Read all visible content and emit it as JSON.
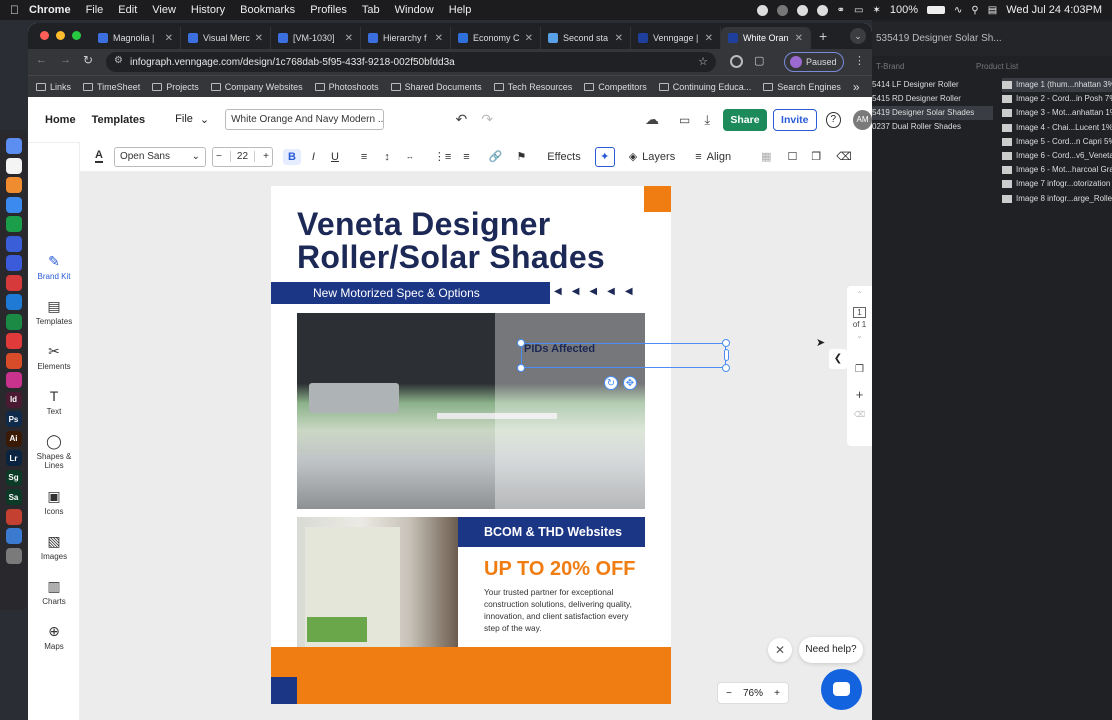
{
  "menubar": {
    "apple": "",
    "items": [
      "Chrome",
      "File",
      "Edit",
      "View",
      "History",
      "Bookmarks",
      "Profiles",
      "Tab",
      "Window",
      "Help"
    ],
    "battery": "100%",
    "datetime": "Wed Jul 24  4:03PM"
  },
  "dock": {
    "apps": [
      {
        "label": "",
        "color": "#5b8ef0"
      },
      {
        "label": "",
        "color": "#f4f4f4"
      },
      {
        "label": "",
        "color": "#f08c30"
      },
      {
        "label": "",
        "color": "#3a8af0"
      },
      {
        "label": "",
        "color": "#1b9e4a"
      },
      {
        "label": "",
        "color": "#3a5dd8"
      },
      {
        "label": "",
        "color": "#3b5bdb"
      },
      {
        "label": "",
        "color": "#d63a3a"
      },
      {
        "label": "",
        "color": "#1f7ad6"
      },
      {
        "label": "",
        "color": "#1a8a45"
      },
      {
        "label": "",
        "color": "#e03a3a"
      },
      {
        "label": "",
        "color": "#d94c2a"
      },
      {
        "label": "",
        "color": "#c9338e"
      },
      {
        "label": "Id",
        "color": "#4a1a33"
      },
      {
        "label": "Ps",
        "color": "#0f2a4a"
      },
      {
        "label": "Ai",
        "color": "#3a1a05"
      },
      {
        "label": "Lr",
        "color": "#0a2340"
      },
      {
        "label": "Sg",
        "color": "#0b3a26"
      },
      {
        "label": "Sa",
        "color": "#0b3a26"
      },
      {
        "label": "",
        "color": "#c44030"
      },
      {
        "label": "",
        "color": "#3a7ad0"
      },
      {
        "label": "",
        "color": "#7a7a7a"
      }
    ]
  },
  "right_panel": {
    "title": "535419 Designer Solar Sh...",
    "col_a": "T-Brand",
    "col_b": "Product List",
    "list_a": [
      {
        "text": "5414 LF Designer Roller",
        "selected": false
      },
      {
        "text": "5415 RD Designer Roller",
        "selected": false
      },
      {
        "text": "5419 Designer Solar Shades",
        "selected": true
      },
      {
        "text": "0237 Dual Roller Shades",
        "selected": false
      }
    ],
    "list_b": [
      {
        "text": "Image 1 (thum...nhattan 3%",
        "selected": true
      },
      {
        "text": "Image 2 - Cord...in Posh 7%",
        "selected": false
      },
      {
        "text": "Image 3 - Mot...anhattan 1%",
        "selected": false
      },
      {
        "text": "Image 4 - Chai...Lucent 1%",
        "selected": false
      },
      {
        "text": "Image 5 - Cord...n Capri 5%",
        "selected": false
      },
      {
        "text": "Image 6 - Cord...v6_Veneta",
        "selected": false
      },
      {
        "text": "Image 6 - Mot...harcoal Gra",
        "selected": false
      },
      {
        "text": "Image 7 infogr...otorization",
        "selected": false
      },
      {
        "text": "Image 8 infogr...arge_Rolle",
        "selected": false
      }
    ]
  },
  "browser": {
    "tabs": [
      {
        "title": "Magnolia |",
        "color": "#3b6fe0",
        "active": false
      },
      {
        "title": "Visual Merc",
        "color": "#3b6fe0",
        "active": false
      },
      {
        "title": "[VM-1030]",
        "color": "#3b6fe0",
        "active": false
      },
      {
        "title": "Hierarchy f",
        "color": "#3b6fe0",
        "active": false
      },
      {
        "title": "Economy C",
        "color": "#2f6fdc",
        "active": false
      },
      {
        "title": "Second sta",
        "color": "#5aa0e6",
        "active": false
      },
      {
        "title": "Venngage |",
        "color": "#1e3f9c",
        "active": false
      },
      {
        "title": "White Oran",
        "color": "#1e3f9c",
        "active": true
      }
    ],
    "url": "infograph.venngage.com/design/1c768dab-5f95-433f-9218-002f50bfdd3a",
    "profile_label": "Paused",
    "bookmarks": [
      "Links",
      "TimeSheet",
      "Projects",
      "Company Websites",
      "Photoshoots",
      "Shared Documents",
      "Tech Resources",
      "Competitors",
      "Continuing Educa...",
      "Search Engines"
    ]
  },
  "app": {
    "nav_home": "Home",
    "nav_templates": "Templates",
    "nav_file": "File",
    "doc_title": "White Orange And Navy Modern ...",
    "share": "Share",
    "invite": "Invite",
    "avatar": "AM",
    "format": {
      "font": "Open Sans",
      "size": "22",
      "effects": "Effects",
      "layers": "Layers",
      "align": "Align"
    },
    "sidebar": [
      {
        "label": "Brand Kit",
        "icon": "✎",
        "active": true
      },
      {
        "label": "Templates",
        "icon": "▤",
        "active": false
      },
      {
        "label": "Elements",
        "icon": "✂",
        "active": false
      },
      {
        "label": "Text",
        "icon": "T",
        "active": false
      },
      {
        "label": "Shapes & Lines",
        "icon": "◯",
        "active": false
      },
      {
        "label": "Icons",
        "icon": "▣",
        "active": false
      },
      {
        "label": "Images",
        "icon": "▧",
        "active": false
      },
      {
        "label": "Charts",
        "icon": "▥",
        "active": false
      },
      {
        "label": "Maps",
        "icon": "⊕",
        "active": false
      }
    ]
  },
  "design": {
    "title": "Veneta Designer Roller/Solar Shades",
    "banner": "New Motorized Spec & Options",
    "selected_text": "PIDs Affected",
    "bcom": "BCOM & THD Websites",
    "offer": "UP TO 20% OFF",
    "body": "Your trusted partner for exceptional construction solutions, delivering quality, innovation, and client satisfaction every step of the way.",
    "colors": {
      "navy": "#1c2855",
      "blue": "#1c3686",
      "orange": "#f07d12"
    }
  },
  "page_nav": {
    "current": "1",
    "total": "of 1"
  },
  "zoom": {
    "value": "76%"
  },
  "help": {
    "label": "Need help?"
  }
}
